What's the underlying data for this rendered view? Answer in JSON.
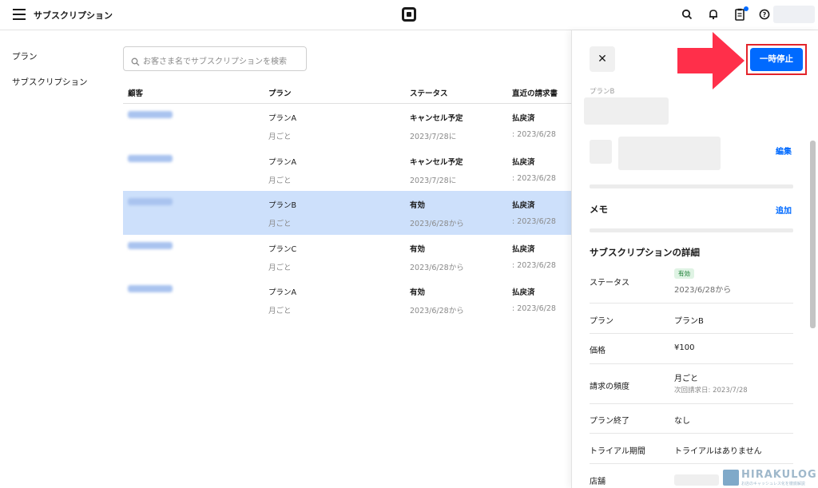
{
  "header": {
    "title": "サブスクリプション"
  },
  "sidebar": {
    "items": [
      {
        "label": "プラン"
      },
      {
        "label": "サブスクリプション"
      }
    ]
  },
  "search": {
    "placeholder": "お客さま名でサブスクリプションを検索"
  },
  "table": {
    "columns": [
      "顧客",
      "プラン",
      "ステータス",
      "直近の請求書"
    ],
    "rows": [
      {
        "plan": "プランA",
        "freq": "月ごと",
        "status": "キャンセル予定",
        "status_date": "2023/7/28に",
        "invoice": "払戻済",
        "invoice_date": ": 2023/6/28",
        "selected": false
      },
      {
        "plan": "プランA",
        "freq": "月ごと",
        "status": "キャンセル予定",
        "status_date": "2023/7/28に",
        "invoice": "払戻済",
        "invoice_date": ": 2023/6/28",
        "selected": false
      },
      {
        "plan": "プランB",
        "freq": "月ごと",
        "status": "有効",
        "status_date": "2023/6/28から",
        "invoice": "払戻済",
        "invoice_date": ": 2023/6/28",
        "selected": true
      },
      {
        "plan": "プランC",
        "freq": "月ごと",
        "status": "有効",
        "status_date": "2023/6/28から",
        "invoice": "払戻済",
        "invoice_date": ": 2023/6/28",
        "selected": false
      },
      {
        "plan": "プランA",
        "freq": "月ごと",
        "status": "有効",
        "status_date": "2023/6/28から",
        "invoice": "払戻済",
        "invoice_date": ": 2023/6/28",
        "selected": false
      }
    ]
  },
  "panel": {
    "close_label": "✕",
    "pause_label": "一時停止",
    "plan_label": "プランB",
    "edit_label": "編集",
    "memo_title": "メモ",
    "add_label": "追加",
    "details_title": "サブスクリプションの詳細",
    "status_label": "ステータス",
    "status_pill": "有効",
    "status_since": "2023/6/28から",
    "plan_row_label": "プラン",
    "plan_value": "プランB",
    "price_label": "価格",
    "price_value": "¥100",
    "freq_label": "請求の頻度",
    "freq_value": "月ごと",
    "next_bill": "次回請求日: 2023/7/28",
    "end_label": "プラン終了",
    "end_value": "なし",
    "trial_label": "トライアル期間",
    "trial_value": "トライアルはありません",
    "store_label": "店舗"
  },
  "watermark": {
    "text": "HIRAKULOG",
    "sub": "お店のキャッシュレス化を徹底解説"
  },
  "colors": {
    "accent": "#006aff",
    "highlight": "#e3242b",
    "selected_row": "#cde0fb"
  }
}
